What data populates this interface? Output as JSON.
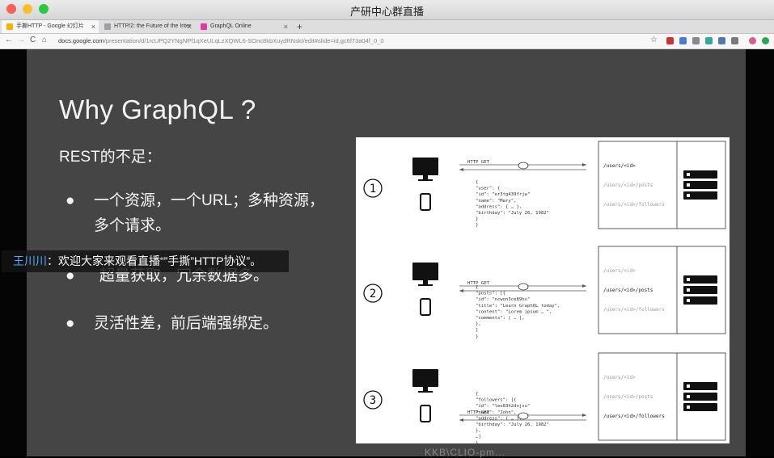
{
  "window": {
    "title": "产研中心群直播",
    "traffic_colors": [
      "#fd5f57",
      "#febc2e",
      "#28c840"
    ]
  },
  "tabs": [
    {
      "label": "手撕HTTP - Google 幻灯片",
      "fav_color": "#f4b400",
      "active": true
    },
    {
      "label": "HTTP/2: the Future of the Inter",
      "fav_color": "#9aa0a6",
      "active": false
    },
    {
      "label": "GraphQL Online",
      "fav_color": "#e535ab",
      "active": false
    }
  ],
  "tab_close": "×",
  "new_tab": "+",
  "address": {
    "host": "docs.google.com",
    "path": "/presentation/d/1rcUPQ2YNgNPf1qXeULqLzXQWL6-SOnc8kbXuydRNskI/edit#slide=id.gc6f73a04f_0_0"
  },
  "nav_icons": {
    "back": "←",
    "forward": "→",
    "reload": "C",
    "home": "⌂",
    "star": "☆"
  },
  "slide": {
    "title": "Why GraphQL ?",
    "subtitle": "REST的不足：",
    "bullet_symbol": "●",
    "bullets": [
      "一个资源，一个URL；多种资源，多个请求。",
      "超量获取，冗余数据多。",
      "灵活性差，前后端强绑定。"
    ]
  },
  "overlay": {
    "user": "王川川",
    "message": "：欢迎大家来观看直播“”手撕”HTTP协议”。"
  },
  "diagram": {
    "request_label": "HTTP GET",
    "panels": [
      {
        "number": "1",
        "json_lines": [
          "{",
          "  \"user\": {",
          "    \"id\": \"er3tg439frjw\"",
          "    \"name\": \"Mary\",",
          "    \"address\": { … },",
          "    \"birthday\": \"July 26, 1982\"",
          "  }",
          "}"
        ],
        "endpoints": [
          "/users/<id>",
          "/users/<id>/posts",
          "/users/<id>/followers"
        ],
        "active_endpoint": 0
      },
      {
        "number": "2",
        "json_lines": [
          "{",
          "  \"posts\": [{",
          "    \"id\": \"ncwon3ce89hs\"",
          "    \"title\": \"Learn GraphQL today\",",
          "    \"content\": \"Lorem ipsum … \",",
          "    \"comments\": [ … ],",
          "  },",
          "  ]",
          "}"
        ],
        "endpoints": [
          "/users/<id>",
          "/users/<id>/posts",
          "/users/<id>/followers"
        ],
        "active_endpoint": 1
      },
      {
        "number": "3",
        "json_lines": [
          "{",
          "  \"followers\": [{",
          "    \"id\": \"leo83h2dojsu\"",
          "    \"name\": \"John\",",
          "    \"address\": { … },",
          "    \"birthday\": \"July 26, 1982\"",
          "  },",
          "  …]",
          "}"
        ],
        "endpoints": [
          "/users/<id>",
          "/users/<id>/posts",
          "/users/<id>/followers"
        ],
        "active_endpoint": 2
      }
    ]
  },
  "bottom_caption": "KKB\\CLIO-pm..."
}
